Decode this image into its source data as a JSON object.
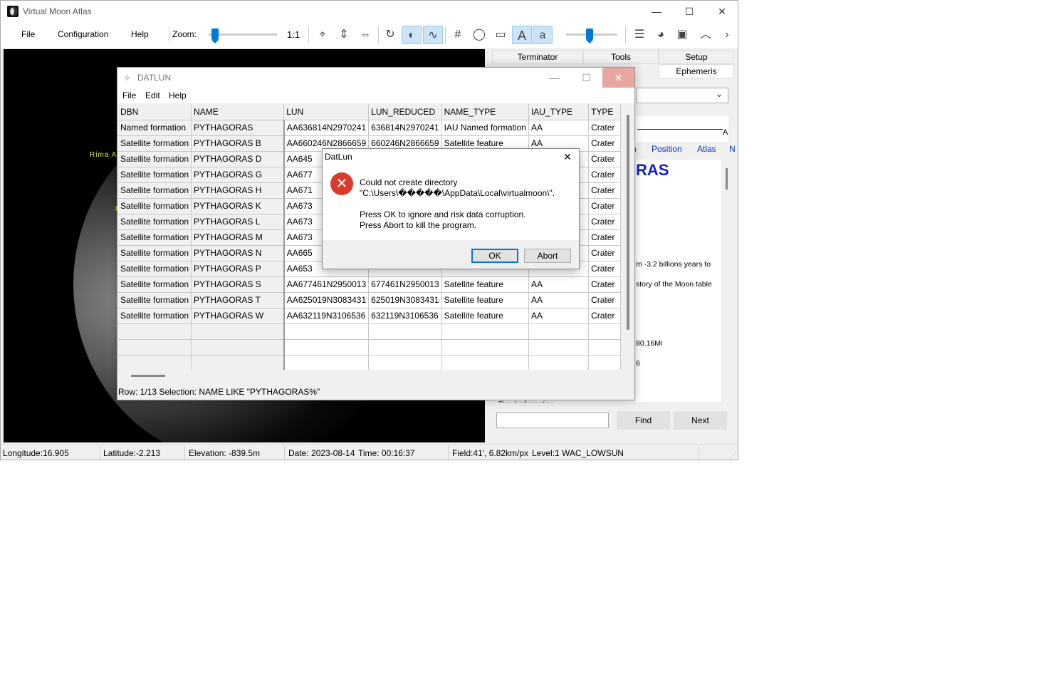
{
  "main": {
    "title": "Virtual Moon Atlas",
    "menu": [
      "File",
      "Configuration",
      "Help"
    ],
    "zoom_label": "Zoom:",
    "zoom_ratio": "1:1",
    "zoom_level": 0.05,
    "toolbar_text_a_upper": "A",
    "toolbar_text_a_lower": "a",
    "brightness_level": 0.45
  },
  "moon_view": {
    "labels": [
      "Rima A",
      "N"
    ]
  },
  "right_panel": {
    "tabs_row1": [
      "Terminator",
      "Tools",
      "Setup"
    ],
    "tabs_row2": [
      "Ephemeris"
    ],
    "field_suffix": "A",
    "links": [
      "n",
      "Position",
      "Atlas",
      "N"
    ],
    "title": "RAS",
    "lines": [
      "m -3.2 billions years to",
      "story of the Moon table",
      "80.16Mi",
      "6",
      "Circular formation"
    ],
    "find_label": "Find",
    "next_label": "Next",
    "search_value": ""
  },
  "status": {
    "longitude": "Longitude:16.905",
    "latitude": "Latitude:-2.213",
    "elevation": "Elevation: -839.5m",
    "date": "Date: 2023-08-14",
    "time": "Time: 00:16:37",
    "field": "Field:41', 6.82km/px",
    "level": "Level:1 WAC_LOWSUN"
  },
  "datlun": {
    "title": "DATLUN",
    "menu": [
      "File",
      "Edit",
      "Help"
    ],
    "columns": [
      "DBN",
      "NAME",
      "LUN",
      "LUN_REDUCED",
      "NAME_TYPE",
      "IAU_TYPE",
      "TYPE"
    ],
    "rows": [
      [
        "Named formation",
        "PYTHAGORAS",
        "AA636814N2970241",
        "636814N2970241",
        "IAU Named formation",
        "AA",
        "Crater"
      ],
      [
        "Satellite formation",
        "PYTHAGORAS B",
        "AA660246N2866659",
        "660246N2866659",
        "Satellite feature",
        "AA",
        "Crater"
      ],
      [
        "Satellite formation",
        "PYTHAGORAS D",
        "AA645",
        "",
        "",
        "",
        "Crater"
      ],
      [
        "Satellite formation",
        "PYTHAGORAS G",
        "AA677",
        "",
        "",
        "",
        "Crater"
      ],
      [
        "Satellite formation",
        "PYTHAGORAS H",
        "AA671",
        "",
        "",
        "",
        "Crater"
      ],
      [
        "Satellite formation",
        "PYTHAGORAS K",
        "AA673",
        "",
        "",
        "",
        "Crater"
      ],
      [
        "Satellite formation",
        "PYTHAGORAS L",
        "AA673",
        "",
        "",
        "",
        "Crater"
      ],
      [
        "Satellite formation",
        "PYTHAGORAS M",
        "AA673",
        "",
        "",
        "",
        "Crater"
      ],
      [
        "Satellite formation",
        "PYTHAGORAS N",
        "AA665",
        "",
        "",
        "",
        "Crater"
      ],
      [
        "Satellite formation",
        "PYTHAGORAS P",
        "AA653",
        "",
        "",
        "",
        "Crater"
      ],
      [
        "Satellite formation",
        "PYTHAGORAS S",
        "AA677461N2950013",
        "677461N2950013",
        "Satellite feature",
        "AA",
        "Crater"
      ],
      [
        "Satellite formation",
        "PYTHAGORAS T",
        "AA625019N3083431",
        "625019N3083431",
        "Satellite feature",
        "AA",
        "Crater"
      ],
      [
        "Satellite formation",
        "PYTHAGORAS W",
        "AA632119N3106536",
        "632119N3106536",
        "Satellite feature",
        "AA",
        "Crater"
      ]
    ],
    "status": "Row: 1/13   Selection: NAME LIKE \"PYTHAGORAS%\""
  },
  "dialog": {
    "title": "DatLun",
    "line1": "Could not create directory",
    "line2": "\"C:\\Users\\�����\\AppData\\Local\\virtualmoon\\\".",
    "line3": "Press OK to ignore and risk data corruption.",
    "line4": "Press Abort to kill the program.",
    "ok_label": "OK",
    "abort_label": "Abort",
    "icon": "error-icon"
  },
  "colors": {
    "accent": "#0078d7",
    "info_title": "#1020d0",
    "link": "#0033cc",
    "moon_label": "#e8e850",
    "error": "#d93b2b"
  }
}
